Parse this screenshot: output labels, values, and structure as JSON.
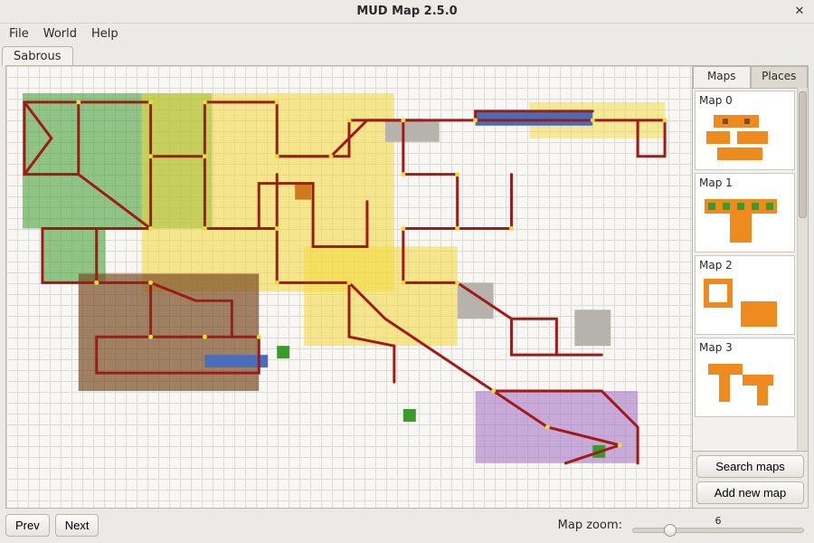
{
  "window": {
    "title": "MUD Map 2.5.0"
  },
  "menu": {
    "file": "File",
    "world": "World",
    "help": "Help"
  },
  "tabs": {
    "world": "Sabrous"
  },
  "side": {
    "tab_maps": "Maps",
    "tab_places": "Places",
    "active_tab": "Maps",
    "maps": [
      {
        "label": "Map 0"
      },
      {
        "label": "Map 1"
      },
      {
        "label": "Map 2"
      },
      {
        "label": "Map 3"
      }
    ],
    "search_btn": "Search maps",
    "add_btn": "Add new map"
  },
  "bottom": {
    "prev": "Prev",
    "next": "Next",
    "zoom_label": "Map zoom:",
    "zoom_value": "6",
    "zoom_min": 1,
    "zoom_max": 20,
    "slider_pos_pct": 22
  },
  "colors": {
    "path": "#a21a17",
    "yellow": "#f2d93a",
    "green": "#3a9a2c",
    "brown": "#7a4d23",
    "orange": "#cf7a1e",
    "purple": "#a876c4",
    "blue": "#4a6db8",
    "gray": "#b5b3ab"
  }
}
